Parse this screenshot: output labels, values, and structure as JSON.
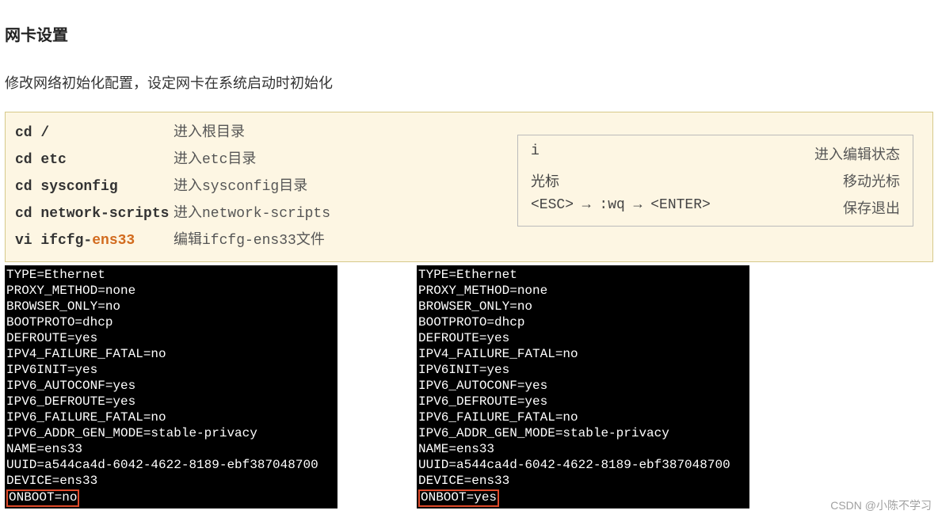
{
  "title": "网卡设置",
  "subtitle": "修改网络初始化配置，设定网卡在系统启动时初始化",
  "commands": [
    {
      "cmd": "cd /",
      "desc_prefix": "进入",
      "desc_mono": "",
      "desc_suffix": "根目录"
    },
    {
      "cmd": "cd etc",
      "desc_prefix": "进入",
      "desc_mono": "etc",
      "desc_suffix": "目录"
    },
    {
      "cmd": "cd sysconfig",
      "desc_prefix": "进入",
      "desc_mono": "sysconfig",
      "desc_suffix": "目录"
    },
    {
      "cmd": "cd network-scripts",
      "desc_prefix": "进入",
      "desc_mono": "network-scripts",
      "desc_suffix": ""
    },
    {
      "cmd_pre": "vi ifcfg-",
      "cmd_orange": "ens33",
      "desc_prefix": "编辑",
      "desc_mono": "ifcfg-ens33",
      "desc_suffix": "文件"
    }
  ],
  "vi_keys": [
    {
      "key": "i",
      "desc": "进入编辑状态",
      "cn": false
    },
    {
      "key": "光标",
      "desc": "移动光标",
      "cn": true
    },
    {
      "key": "<ESC> → :wq → <ENTER>",
      "desc": "保存退出",
      "cn": false
    }
  ],
  "terminal_common": [
    "TYPE=Ethernet",
    "PROXY_METHOD=none",
    "BROWSER_ONLY=no",
    "BOOTPROTO=dhcp",
    "DEFROUTE=yes",
    "IPV4_FAILURE_FATAL=no",
    "IPV6INIT=yes",
    "IPV6_AUTOCONF=yes",
    "IPV6_DEFROUTE=yes",
    "IPV6_FAILURE_FATAL=no",
    "IPV6_ADDR_GEN_MODE=stable-privacy",
    "NAME=ens33",
    "UUID=a544ca4d-6042-4622-8189-ebf387048700",
    "DEVICE=ens33"
  ],
  "onboot_left": "ONBOOT=no",
  "onboot_right": "ONBOOT=yes",
  "watermark": "CSDN @小陈不学习"
}
